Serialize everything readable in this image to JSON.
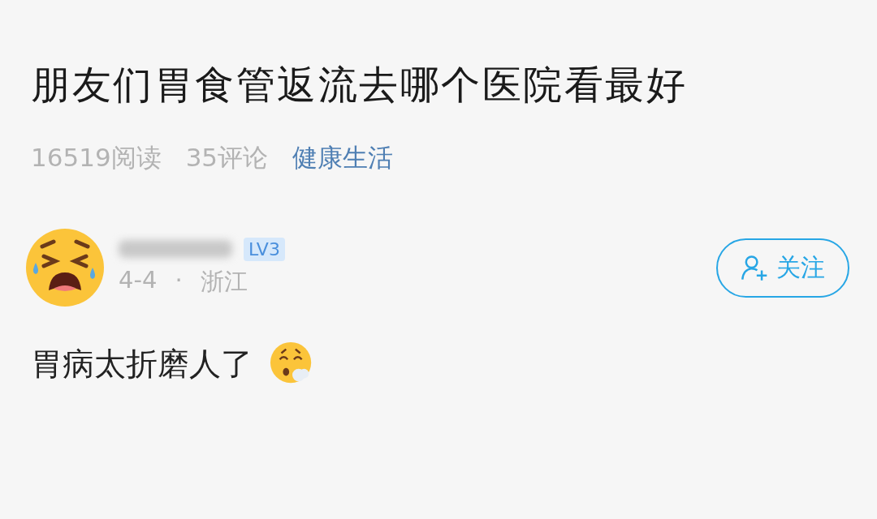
{
  "post": {
    "title": "朋友们胃食管返流去哪个医院看最好",
    "views": "16519阅读",
    "comments": "35评论",
    "topic": "健康生活"
  },
  "comment": {
    "level_badge": "LV3",
    "date": "4-4",
    "separator": "·",
    "location": "浙江",
    "follow_button": "关注",
    "text": "胃病太折磨人了"
  }
}
